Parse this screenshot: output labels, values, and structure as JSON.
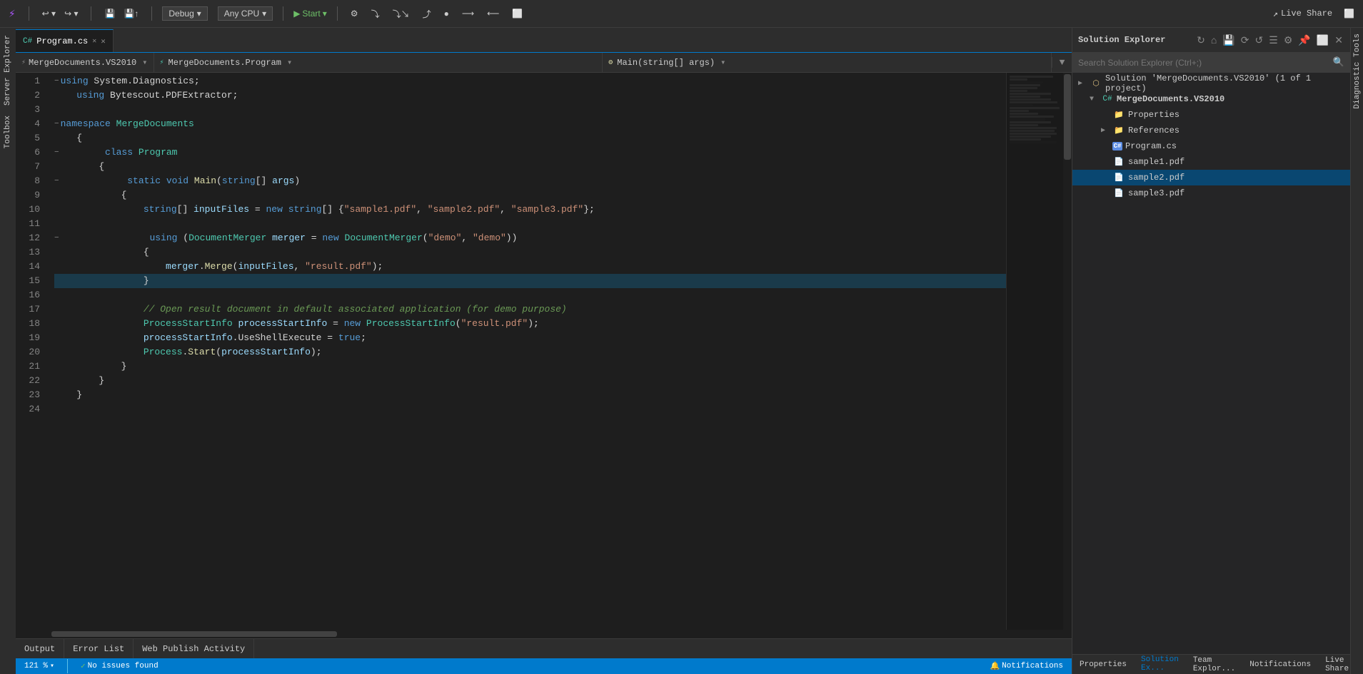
{
  "titlebar": {
    "debug_label": "Debug",
    "cpu_label": "Any CPU",
    "start_label": "Start",
    "live_share_label": "Live Share"
  },
  "tabs": {
    "active_tab": "Program.cs"
  },
  "navbar": {
    "namespace_path": "MergeDocuments.VS2010",
    "class_path": "MergeDocuments.Program",
    "method_path": "Main(string[] args)"
  },
  "code": {
    "lines": [
      {
        "num": 1,
        "indent": 1,
        "tokens": [
          {
            "t": "collapse",
            "v": "−"
          },
          {
            "t": "kw",
            "v": "using"
          },
          {
            "t": "plain",
            "v": " System.Diagnostics;"
          }
        ]
      },
      {
        "num": 2,
        "indent": 1,
        "tokens": [
          {
            "t": "plain",
            "v": "    "
          },
          {
            "t": "kw",
            "v": "using"
          },
          {
            "t": "plain",
            "v": " Bytescout.PDFExtractor;"
          }
        ]
      },
      {
        "num": 3,
        "indent": 0,
        "tokens": []
      },
      {
        "num": 4,
        "indent": 0,
        "tokens": [
          {
            "t": "collapse",
            "v": "−"
          },
          {
            "t": "kw",
            "v": "namespace"
          },
          {
            "t": "plain",
            "v": " "
          },
          {
            "t": "ns",
            "v": "MergeDocuments"
          }
        ]
      },
      {
        "num": 5,
        "indent": 1,
        "tokens": [
          {
            "t": "plain",
            "v": "    {"
          }
        ]
      },
      {
        "num": 6,
        "indent": 1,
        "tokens": [
          {
            "t": "collapse",
            "v": "−"
          },
          {
            "t": "plain",
            "v": "        "
          },
          {
            "t": "kw",
            "v": "class"
          },
          {
            "t": "plain",
            "v": " "
          },
          {
            "t": "type",
            "v": "Program"
          }
        ]
      },
      {
        "num": 7,
        "indent": 2,
        "tokens": [
          {
            "t": "plain",
            "v": "        {"
          }
        ]
      },
      {
        "num": 8,
        "indent": 2,
        "tokens": [
          {
            "t": "collapse",
            "v": "−"
          },
          {
            "t": "plain",
            "v": "            "
          },
          {
            "t": "kw",
            "v": "static"
          },
          {
            "t": "plain",
            "v": " "
          },
          {
            "t": "kw",
            "v": "void"
          },
          {
            "t": "plain",
            "v": " "
          },
          {
            "t": "method",
            "v": "Main"
          },
          {
            "t": "plain",
            "v": "("
          },
          {
            "t": "kw",
            "v": "string"
          },
          {
            "t": "plain",
            "v": "[] "
          },
          {
            "t": "param",
            "v": "args"
          },
          {
            "t": "plain",
            "v": ")"
          }
        ]
      },
      {
        "num": 9,
        "indent": 3,
        "tokens": [
          {
            "t": "plain",
            "v": "            {"
          }
        ]
      },
      {
        "num": 10,
        "indent": 3,
        "tokens": [
          {
            "t": "plain",
            "v": "                "
          },
          {
            "t": "kw",
            "v": "string"
          },
          {
            "t": "plain",
            "v": "[] "
          },
          {
            "t": "var-name",
            "v": "inputFiles"
          },
          {
            "t": "plain",
            "v": " = "
          },
          {
            "t": "kw",
            "v": "new"
          },
          {
            "t": "plain",
            "v": " "
          },
          {
            "t": "kw",
            "v": "string"
          },
          {
            "t": "plain",
            "v": "[] {"
          },
          {
            "t": "str",
            "v": "\"sample1.pdf\""
          },
          {
            "t": "plain",
            "v": ", "
          },
          {
            "t": "str",
            "v": "\"sample2.pdf\""
          },
          {
            "t": "plain",
            "v": ", "
          },
          {
            "t": "str",
            "v": "\"sample3.pdf\""
          },
          {
            "t": "plain",
            "v": "};"
          }
        ]
      },
      {
        "num": 11,
        "indent": 0,
        "tokens": []
      },
      {
        "num": 12,
        "indent": 3,
        "tokens": [
          {
            "t": "collapse",
            "v": "−"
          },
          {
            "t": "plain",
            "v": "                "
          },
          {
            "t": "kw",
            "v": "using"
          },
          {
            "t": "plain",
            "v": " ("
          },
          {
            "t": "type",
            "v": "DocumentMerger"
          },
          {
            "t": "plain",
            "v": " "
          },
          {
            "t": "var-name",
            "v": "merger"
          },
          {
            "t": "plain",
            "v": " = "
          },
          {
            "t": "kw",
            "v": "new"
          },
          {
            "t": "plain",
            "v": " "
          },
          {
            "t": "type",
            "v": "DocumentMerger"
          },
          {
            "t": "plain",
            "v": "("
          },
          {
            "t": "str",
            "v": "\"demo\""
          },
          {
            "t": "plain",
            "v": ", "
          },
          {
            "t": "str",
            "v": "\"demo\""
          },
          {
            "t": "plain",
            "v": "))"
          }
        ]
      },
      {
        "num": 13,
        "indent": 4,
        "tokens": [
          {
            "t": "plain",
            "v": "                {"
          }
        ]
      },
      {
        "num": 14,
        "indent": 4,
        "tokens": [
          {
            "t": "plain",
            "v": "                    "
          },
          {
            "t": "var-name",
            "v": "merger"
          },
          {
            "t": "plain",
            "v": "."
          },
          {
            "t": "method",
            "v": "Merge"
          },
          {
            "t": "plain",
            "v": "("
          },
          {
            "t": "var-name",
            "v": "inputFiles"
          },
          {
            "t": "plain",
            "v": ", "
          },
          {
            "t": "str",
            "v": "\"result.pdf\""
          },
          {
            "t": "plain",
            "v": ");"
          }
        ]
      },
      {
        "num": 15,
        "indent": 4,
        "tokens": [
          {
            "t": "plain",
            "v": "                }"
          }
        ],
        "highlight": true
      },
      {
        "num": 16,
        "indent": 0,
        "tokens": []
      },
      {
        "num": 17,
        "indent": 3,
        "tokens": [
          {
            "t": "plain",
            "v": "                "
          },
          {
            "t": "comment",
            "v": "// Open result document in default associated application (for demo purpose)"
          }
        ]
      },
      {
        "num": 18,
        "indent": 3,
        "tokens": [
          {
            "t": "plain",
            "v": "                "
          },
          {
            "t": "type",
            "v": "ProcessStartInfo"
          },
          {
            "t": "plain",
            "v": " "
          },
          {
            "t": "var-name",
            "v": "processStartInfo"
          },
          {
            "t": "plain",
            "v": " = "
          },
          {
            "t": "kw",
            "v": "new"
          },
          {
            "t": "plain",
            "v": " "
          },
          {
            "t": "type",
            "v": "ProcessStartInfo"
          },
          {
            "t": "plain",
            "v": "("
          },
          {
            "t": "str",
            "v": "\"result.pdf\""
          },
          {
            "t": "plain",
            "v": ");"
          }
        ]
      },
      {
        "num": 19,
        "indent": 3,
        "tokens": [
          {
            "t": "plain",
            "v": "                "
          },
          {
            "t": "var-name",
            "v": "processStartInfo"
          },
          {
            "t": "plain",
            "v": ".UseShellExecute = "
          },
          {
            "t": "kw",
            "v": "true"
          },
          {
            "t": "plain",
            "v": ";"
          }
        ]
      },
      {
        "num": 20,
        "indent": 3,
        "tokens": [
          {
            "t": "plain",
            "v": "                "
          },
          {
            "t": "type",
            "v": "Process"
          },
          {
            "t": "plain",
            "v": "."
          },
          {
            "t": "method",
            "v": "Start"
          },
          {
            "t": "plain",
            "v": "("
          },
          {
            "t": "var-name",
            "v": "processStartInfo"
          },
          {
            "t": "plain",
            "v": ");"
          }
        ]
      },
      {
        "num": 21,
        "indent": 3,
        "tokens": [
          {
            "t": "plain",
            "v": "            }"
          }
        ]
      },
      {
        "num": 22,
        "indent": 2,
        "tokens": [
          {
            "t": "plain",
            "v": "        }"
          }
        ]
      },
      {
        "num": 23,
        "indent": 1,
        "tokens": [
          {
            "t": "plain",
            "v": "    }"
          }
        ]
      },
      {
        "num": 24,
        "indent": 0,
        "tokens": []
      }
    ]
  },
  "solution_explorer": {
    "title": "Solution Explorer",
    "search_placeholder": "Search Solution Explorer (Ctrl+;)",
    "tree": [
      {
        "id": "solution",
        "level": 0,
        "arrow": "▶",
        "icon": "solution",
        "label": "Solution 'MergeDocuments.VS2010' (1 of 1 project)",
        "bold": false
      },
      {
        "id": "project",
        "level": 1,
        "arrow": "▼",
        "icon": "project",
        "label": "MergeDocuments.VS2010",
        "bold": true
      },
      {
        "id": "properties",
        "level": 2,
        "arrow": " ",
        "icon": "folder",
        "label": "Properties",
        "bold": false
      },
      {
        "id": "references",
        "level": 2,
        "arrow": "▶",
        "icon": "folder",
        "label": "References",
        "bold": false
      },
      {
        "id": "program_cs",
        "level": 2,
        "arrow": " ",
        "icon": "cs",
        "label": "Program.cs",
        "bold": false
      },
      {
        "id": "sample1",
        "level": 2,
        "arrow": " ",
        "icon": "pdf",
        "label": "sample1.pdf",
        "bold": false
      },
      {
        "id": "sample2",
        "level": 2,
        "arrow": " ",
        "icon": "pdf",
        "label": "sample2.pdf",
        "bold": false,
        "selected": true
      },
      {
        "id": "sample3",
        "level": 2,
        "arrow": " ",
        "icon": "pdf",
        "label": "sample3.pdf",
        "bold": false
      }
    ]
  },
  "right_bottom_tabs": [
    {
      "id": "properties",
      "label": "Properties"
    },
    {
      "id": "solution_ex",
      "label": "Solution Ex...",
      "active": true
    },
    {
      "id": "team_explorer",
      "label": "Team Explor..."
    },
    {
      "id": "notifications",
      "label": "Notifications"
    },
    {
      "id": "live_share",
      "label": "Live Share"
    }
  ],
  "status_bar": {
    "zoom": "121 %",
    "no_issues": "No issues found",
    "notifications": "Notifications"
  },
  "bottom_tabs": [
    {
      "id": "output",
      "label": "Output"
    },
    {
      "id": "error_list",
      "label": "Error List"
    },
    {
      "id": "web_publish",
      "label": "Web Publish Activity"
    }
  ],
  "left_sidebar": {
    "server_explorer": "Server Explorer",
    "toolbox": "Toolbox"
  },
  "diagnostics_sidebar": {
    "label": "Diagnostic Tools"
  }
}
